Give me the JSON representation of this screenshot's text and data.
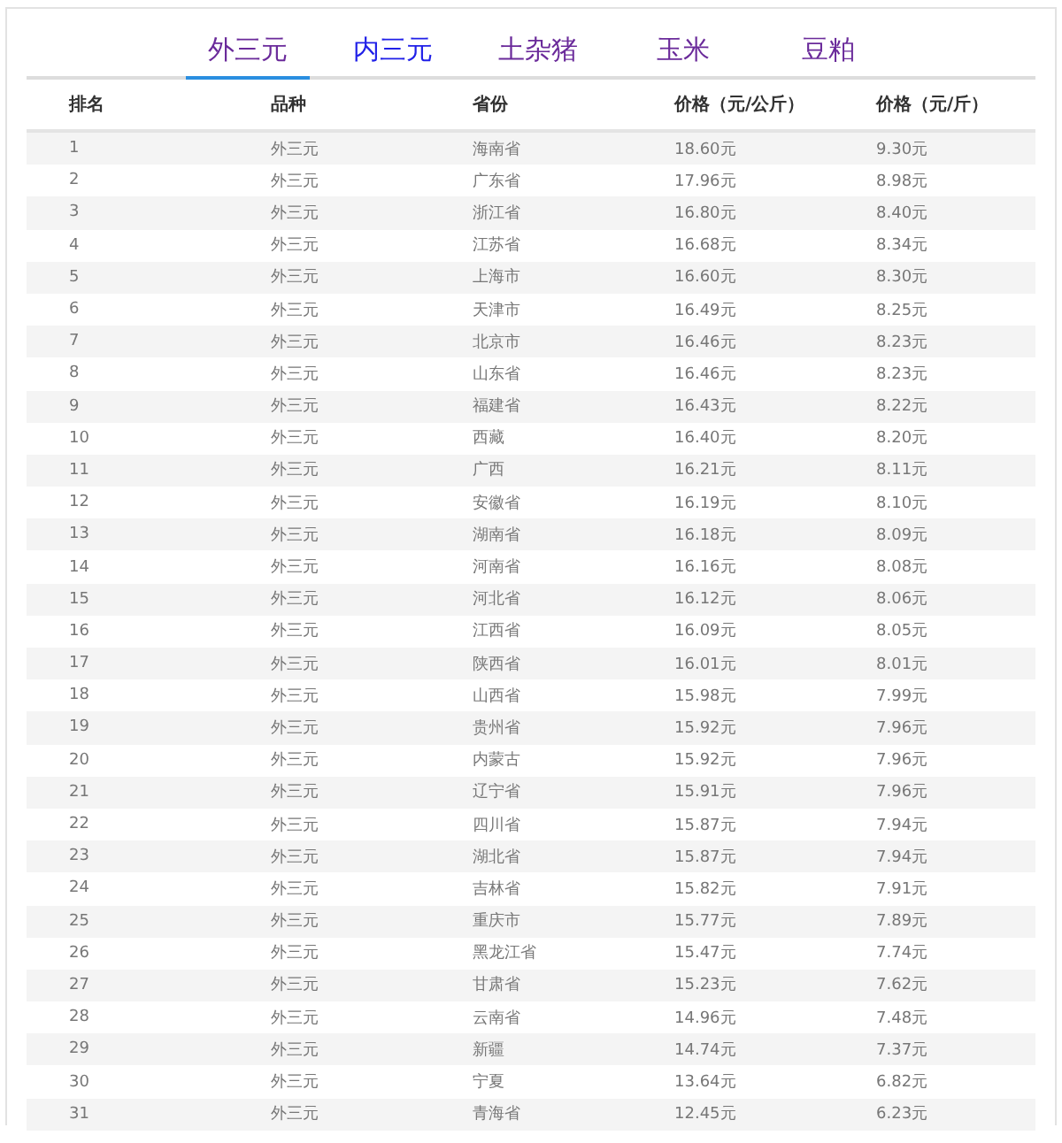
{
  "tabs": [
    {
      "label": "外三元",
      "selected": true,
      "visited": true
    },
    {
      "label": "内三元",
      "selected": false,
      "visited": false
    },
    {
      "label": "土杂猪",
      "selected": false,
      "visited": true
    },
    {
      "label": "玉米",
      "selected": false,
      "visited": true
    },
    {
      "label": "豆粕",
      "selected": false,
      "visited": true
    }
  ],
  "table": {
    "columns": [
      "排名",
      "品种",
      "省份",
      "价格（元/公斤）",
      "价格（元/斤）"
    ],
    "rows": [
      [
        "1",
        "外三元",
        "海南省",
        "18.60元",
        "9.30元"
      ],
      [
        "2",
        "外三元",
        "广东省",
        "17.96元",
        "8.98元"
      ],
      [
        "3",
        "外三元",
        "浙江省",
        "16.80元",
        "8.40元"
      ],
      [
        "4",
        "外三元",
        "江苏省",
        "16.68元",
        "8.34元"
      ],
      [
        "5",
        "外三元",
        "上海市",
        "16.60元",
        "8.30元"
      ],
      [
        "6",
        "外三元",
        "天津市",
        "16.49元",
        "8.25元"
      ],
      [
        "7",
        "外三元",
        "北京市",
        "16.46元",
        "8.23元"
      ],
      [
        "8",
        "外三元",
        "山东省",
        "16.46元",
        "8.23元"
      ],
      [
        "9",
        "外三元",
        "福建省",
        "16.43元",
        "8.22元"
      ],
      [
        "10",
        "外三元",
        "西藏",
        "16.40元",
        "8.20元"
      ],
      [
        "11",
        "外三元",
        "广西",
        "16.21元",
        "8.11元"
      ],
      [
        "12",
        "外三元",
        "安徽省",
        "16.19元",
        "8.10元"
      ],
      [
        "13",
        "外三元",
        "湖南省",
        "16.18元",
        "8.09元"
      ],
      [
        "14",
        "外三元",
        "河南省",
        "16.16元",
        "8.08元"
      ],
      [
        "15",
        "外三元",
        "河北省",
        "16.12元",
        "8.06元"
      ],
      [
        "16",
        "外三元",
        "江西省",
        "16.09元",
        "8.05元"
      ],
      [
        "17",
        "外三元",
        "陕西省",
        "16.01元",
        "8.01元"
      ],
      [
        "18",
        "外三元",
        "山西省",
        "15.98元",
        "7.99元"
      ],
      [
        "19",
        "外三元",
        "贵州省",
        "15.92元",
        "7.96元"
      ],
      [
        "20",
        "外三元",
        "内蒙古",
        "15.92元",
        "7.96元"
      ],
      [
        "21",
        "外三元",
        "辽宁省",
        "15.91元",
        "7.96元"
      ],
      [
        "22",
        "外三元",
        "四川省",
        "15.87元",
        "7.94元"
      ],
      [
        "23",
        "外三元",
        "湖北省",
        "15.87元",
        "7.94元"
      ],
      [
        "24",
        "外三元",
        "吉林省",
        "15.82元",
        "7.91元"
      ],
      [
        "25",
        "外三元",
        "重庆市",
        "15.77元",
        "7.89元"
      ],
      [
        "26",
        "外三元",
        "黑龙江省",
        "15.47元",
        "7.74元"
      ],
      [
        "27",
        "外三元",
        "甘肃省",
        "15.23元",
        "7.62元"
      ],
      [
        "28",
        "外三元",
        "云南省",
        "14.96元",
        "7.48元"
      ],
      [
        "29",
        "外三元",
        "新疆",
        "14.74元",
        "7.37元"
      ],
      [
        "30",
        "外三元",
        "宁夏",
        "13.64元",
        "6.82元"
      ],
      [
        "31",
        "外三元",
        "青海省",
        "12.45元",
        "6.23元"
      ]
    ]
  }
}
